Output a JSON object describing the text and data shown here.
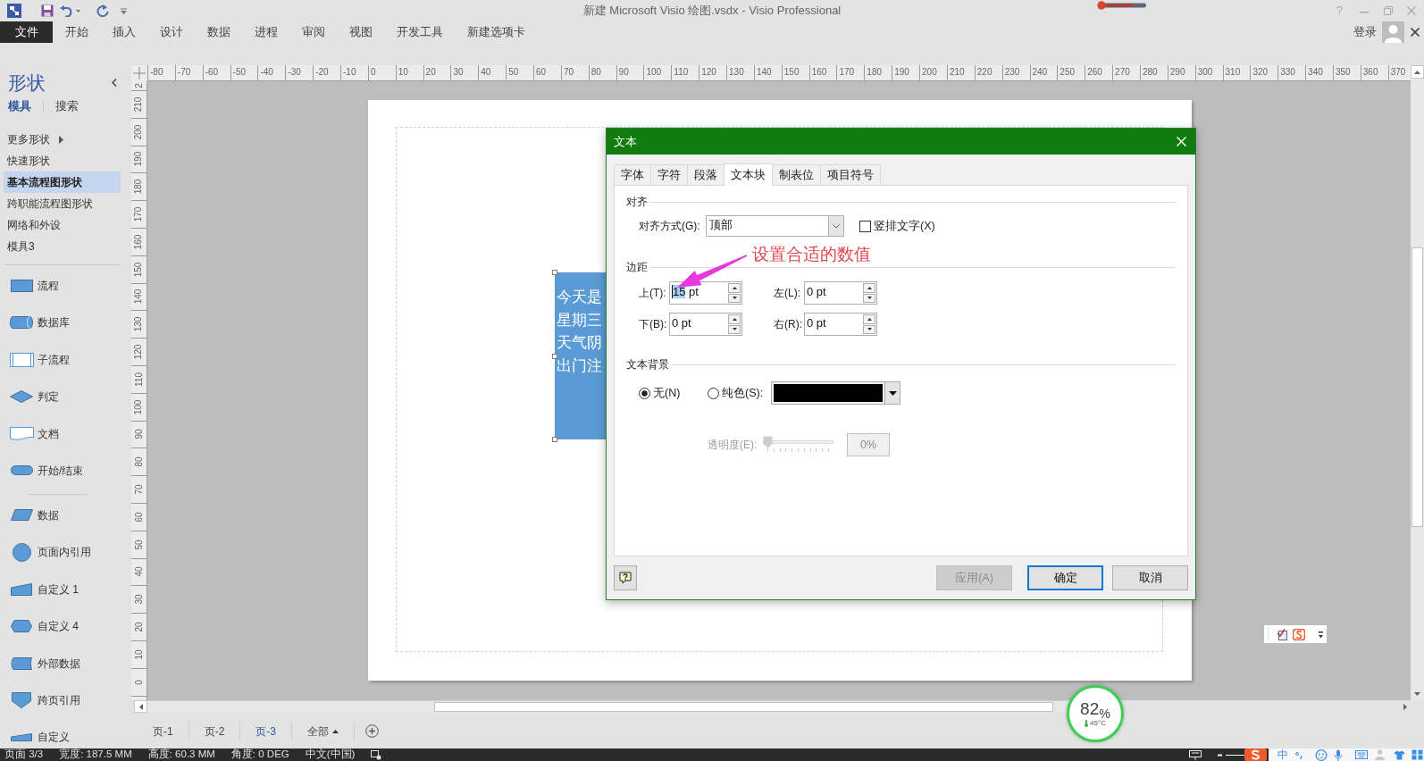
{
  "window": {
    "title": "新建 Microsoft Visio 绘图.vsdx - Visio Professional",
    "help": "?"
  },
  "ribbon": {
    "tabs": [
      {
        "label": "文件",
        "kind": "file"
      },
      {
        "label": "开始",
        "kind": "tab"
      },
      {
        "label": "插入",
        "kind": "tab"
      },
      {
        "label": "设计",
        "kind": "tab"
      },
      {
        "label": "数据",
        "kind": "tab"
      },
      {
        "label": "进程",
        "kind": "tab"
      },
      {
        "label": "审阅",
        "kind": "tab"
      },
      {
        "label": "视图",
        "kind": "tab"
      },
      {
        "label": "开发工具",
        "kind": "tab"
      },
      {
        "label": "新建选项卡",
        "kind": "tab"
      }
    ],
    "sign_in": "登录"
  },
  "shapes_panel": {
    "title": "形状",
    "tabs": [
      {
        "label": "模具",
        "selected": true
      },
      {
        "label": "搜索",
        "selected": false
      }
    ],
    "stencils": [
      {
        "label": "更多形状",
        "kind": "submenu",
        "selected": false
      },
      {
        "label": "快速形状",
        "kind": "stencil",
        "selected": false
      },
      {
        "label": "基本流程图形状",
        "kind": "stencil",
        "selected": true
      },
      {
        "label": "跨职能流程图形状",
        "kind": "stencil",
        "selected": false
      },
      {
        "label": "网络和外设",
        "kind": "stencil",
        "selected": false
      },
      {
        "label": "模具3",
        "kind": "stencil",
        "selected": false
      }
    ],
    "shape_groups": [
      {
        "shapes": [
          {
            "label": "流程",
            "kind": "process"
          },
          {
            "label": "数据库",
            "kind": "database"
          },
          {
            "label": "子流程",
            "kind": "subprocess"
          },
          {
            "label": "判定",
            "kind": "decision"
          },
          {
            "label": "文档",
            "kind": "document"
          },
          {
            "label": "开始/结束",
            "kind": "terminator"
          }
        ]
      },
      {
        "shapes": [
          {
            "label": "数据",
            "kind": "data"
          },
          {
            "label": "页面内引用",
            "kind": "onpage_reference"
          },
          {
            "label": "自定义 1",
            "kind": "custom_1"
          },
          {
            "label": "自定义 4",
            "kind": "custom_4"
          },
          {
            "label": "外部数据",
            "kind": "external_data"
          },
          {
            "label": "跨页引用",
            "kind": "offpage_reference"
          },
          {
            "label": "自定义",
            "kind": "custom_cut"
          }
        ]
      }
    ]
  },
  "rulers": {
    "horizontal": [
      "-80",
      "-70",
      "-60",
      "-50",
      "-40",
      "-30",
      "-20",
      "-10",
      "0",
      "10",
      "20",
      "30",
      "40",
      "50",
      "60",
      "70",
      "80",
      "90",
      "100",
      "110",
      "120",
      "130",
      "140",
      "150",
      "160",
      "170",
      "180",
      "190",
      "200",
      "210",
      "220",
      "230",
      "240",
      "250",
      "260",
      "270",
      "280",
      "290",
      "300",
      "310",
      "320",
      "330",
      "340",
      "350",
      "360",
      "370"
    ],
    "vertical": [
      "2",
      "210",
      "200",
      "190",
      "180",
      "170",
      "160",
      "150",
      "140",
      "130",
      "120",
      "110",
      "100",
      "90",
      "80",
      "70",
      "60",
      "50",
      "40",
      "30",
      "20",
      "10",
      "0"
    ]
  },
  "drawing": {
    "shape": {
      "lines": [
        "今天是",
        "星期三",
        "天气阴",
        "出门注"
      ],
      "selected": true
    }
  },
  "annotation": {
    "text": "设置合适的数值"
  },
  "dialog": {
    "title": "文本",
    "tabs": [
      {
        "label": "字体",
        "selected": false
      },
      {
        "label": "字符",
        "selected": false
      },
      {
        "label": "段落",
        "selected": false
      },
      {
        "label": "文本块",
        "selected": true
      },
      {
        "label": "制表位",
        "selected": false
      },
      {
        "label": "项目符号",
        "selected": false
      }
    ],
    "alignment": {
      "heading": "对齐",
      "label": "对齐方式(G):",
      "value": "顶部",
      "vertical_text": {
        "label": "竖排文字(X)",
        "checked": false
      }
    },
    "margins": {
      "heading": "边距",
      "fields": [
        {
          "label": "上(T):",
          "value": "15 pt",
          "text_selected": true
        },
        {
          "label": "左(L):",
          "value": "0 pt",
          "text_selected": false
        },
        {
          "label": "下(B):",
          "value": "0 pt",
          "text_selected": false
        },
        {
          "label": "右(R):",
          "value": "0 pt",
          "text_selected": false
        }
      ]
    },
    "background": {
      "heading": "文本背景",
      "options": [
        {
          "label": "无(N)",
          "selected": true
        },
        {
          "label": "纯色(S):",
          "selected": false
        }
      ],
      "color": "#000000",
      "transparency": {
        "label": "透明度(E):",
        "level": 0,
        "reading": "0%",
        "disabled": true
      }
    },
    "buttons": [
      {
        "label": "应用(A)",
        "disabled": true,
        "default": false
      },
      {
        "label": "确定",
        "disabled": false,
        "default": true
      },
      {
        "label": "取消",
        "disabled": false,
        "default": false
      }
    ]
  },
  "page_tabs": [
    {
      "label": "页-1",
      "kind": "page",
      "selected": false
    },
    {
      "label": "页-2",
      "kind": "page",
      "selected": false
    },
    {
      "label": "页-3",
      "kind": "page",
      "selected": true
    },
    {
      "label": "全部",
      "kind": "all",
      "selected": false
    }
  ],
  "status_bar": {
    "items": [
      "页面 3/3",
      "宽度: 187.5 MM",
      "高度: 60.3 MM",
      "角度: 0 DEG",
      "中文(中国)"
    ],
    "input_mode": "中"
  },
  "system_monitor": {
    "usage": "82$_{%}$",
    "temperature": "45°C"
  }
}
